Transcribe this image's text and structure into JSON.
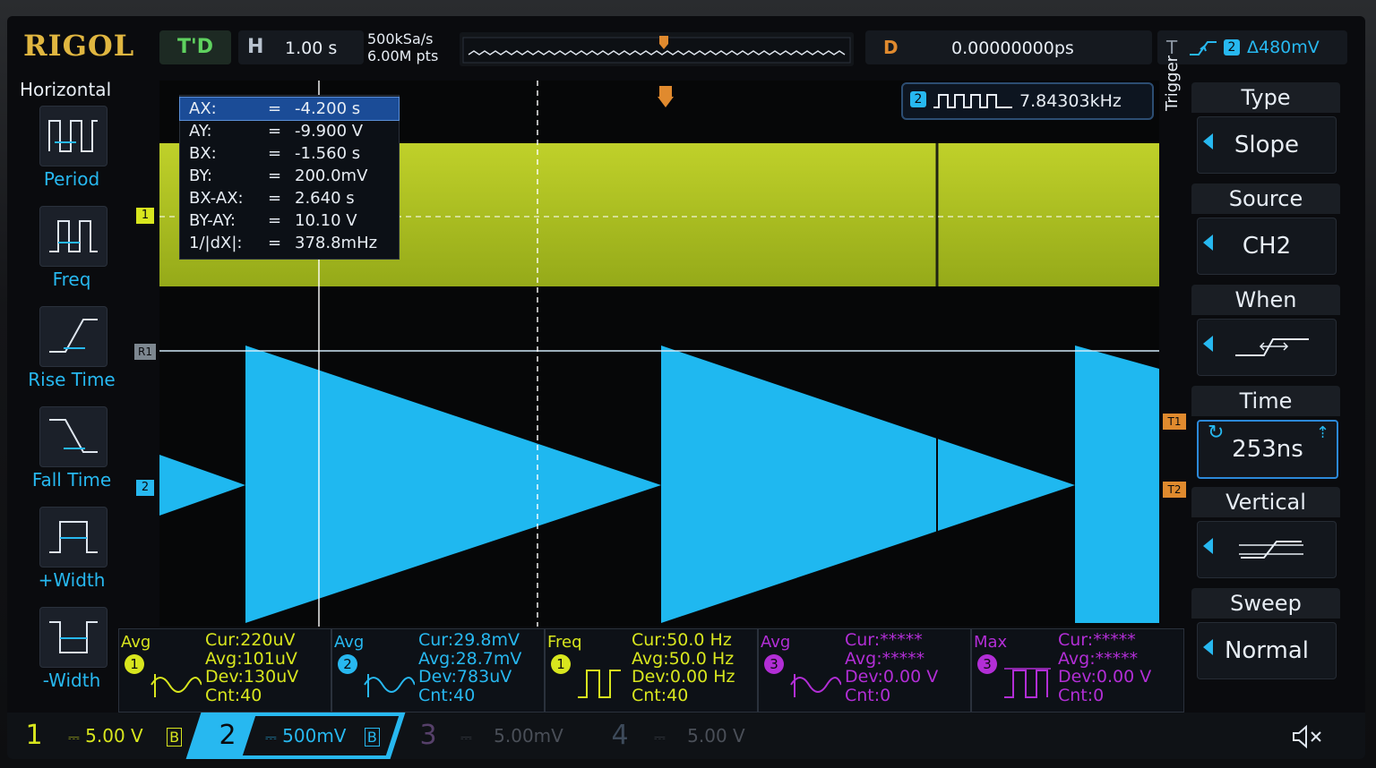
{
  "brand": "RIGOL",
  "run_state": "T'D",
  "horizontal": {
    "label": "H",
    "timebase": "1.00 s",
    "sample_rate": "500kSa/s",
    "memory": "6.00M pts"
  },
  "delay": {
    "label": "D",
    "value": "0.00000000ps"
  },
  "trigger_status": {
    "label": "T",
    "source_num": "2",
    "level": "Δ480mV"
  },
  "left_menu": {
    "title": "Horizontal",
    "items": [
      {
        "label": "Period",
        "icon": "period-icon"
      },
      {
        "label": "Freq",
        "icon": "freq-icon"
      },
      {
        "label": "Rise Time",
        "icon": "rise-time-icon"
      },
      {
        "label": "Fall Time",
        "icon": "fall-time-icon"
      },
      {
        "label": "+Width",
        "icon": "pos-width-icon"
      },
      {
        "label": "-Width",
        "icon": "neg-width-icon"
      }
    ]
  },
  "cursor_readout": [
    {
      "key": "AX:",
      "eq": "=",
      "value": "-4.200 s"
    },
    {
      "key": "AY:",
      "eq": "=",
      "value": "-9.900 V"
    },
    {
      "key": "BX:",
      "eq": "=",
      "value": "-1.560 s"
    },
    {
      "key": "BY:",
      "eq": "=",
      "value": "200.0mV"
    },
    {
      "key": "BX-AX:",
      "eq": "=",
      "value": "2.640 s"
    },
    {
      "key": "BY-AY:",
      "eq": "=",
      "value": "10.10 V"
    },
    {
      "key": "1/|dX|:",
      "eq": "=",
      "value": "378.8mHz"
    }
  ],
  "freq_counter": {
    "channel": "2",
    "value": "7.84303kHz"
  },
  "markers": {
    "ch1": "1",
    "ref": "R1",
    "ch2": "2",
    "t1": "T1",
    "t2": "T2"
  },
  "right_menu": {
    "title": "Trigger",
    "groups": [
      {
        "header": "Type",
        "value": "Slope"
      },
      {
        "header": "Source",
        "value": "CH2"
      },
      {
        "header": "When",
        "value": "",
        "icon": "slope-when-icon"
      },
      {
        "header": "Time",
        "value": "253ns"
      },
      {
        "header": "Vertical",
        "value": "",
        "icon": "vertical-window-icon"
      },
      {
        "header": "Sweep",
        "value": "Normal"
      }
    ]
  },
  "measurements": [
    {
      "name": "Avg",
      "channel": "1",
      "cur": "Cur:220uV",
      "avg": "Avg:101uV",
      "dev": "Dev:130uV",
      "cnt": "Cnt:40"
    },
    {
      "name": "Avg",
      "channel": "2",
      "cur": "Cur:29.8mV",
      "avg": "Avg:28.7mV",
      "dev": "Dev:783uV",
      "cnt": "Cnt:40"
    },
    {
      "name": "Freq",
      "channel": "1",
      "cur": "Cur:50.0 Hz",
      "avg": "Avg:50.0 Hz",
      "dev": "Dev:0.00 Hz",
      "cnt": "Cnt:40"
    },
    {
      "name": "Avg",
      "channel": "3",
      "cur": "Cur:*****",
      "avg": "Avg:*****",
      "dev": "Dev:0.00 V",
      "cnt": "Cnt:0"
    },
    {
      "name": "Max",
      "channel": "3",
      "cur": "Cur:*****",
      "avg": "Avg:*****",
      "dev": "Dev:0.00 V",
      "cnt": "Cnt:0"
    }
  ],
  "channels": [
    {
      "num": "1",
      "scale": "5.00 V"
    },
    {
      "num": "2",
      "scale": "500mV"
    },
    {
      "num": "3",
      "scale": "5.00mV"
    },
    {
      "num": "4",
      "scale": "5.00 V"
    }
  ],
  "colors": {
    "ch1": "#d8e61e",
    "ch2": "#27b8f0",
    "ch3": "#b22ed6",
    "trigger": "#e08a2e",
    "brand": "#e0b640"
  }
}
